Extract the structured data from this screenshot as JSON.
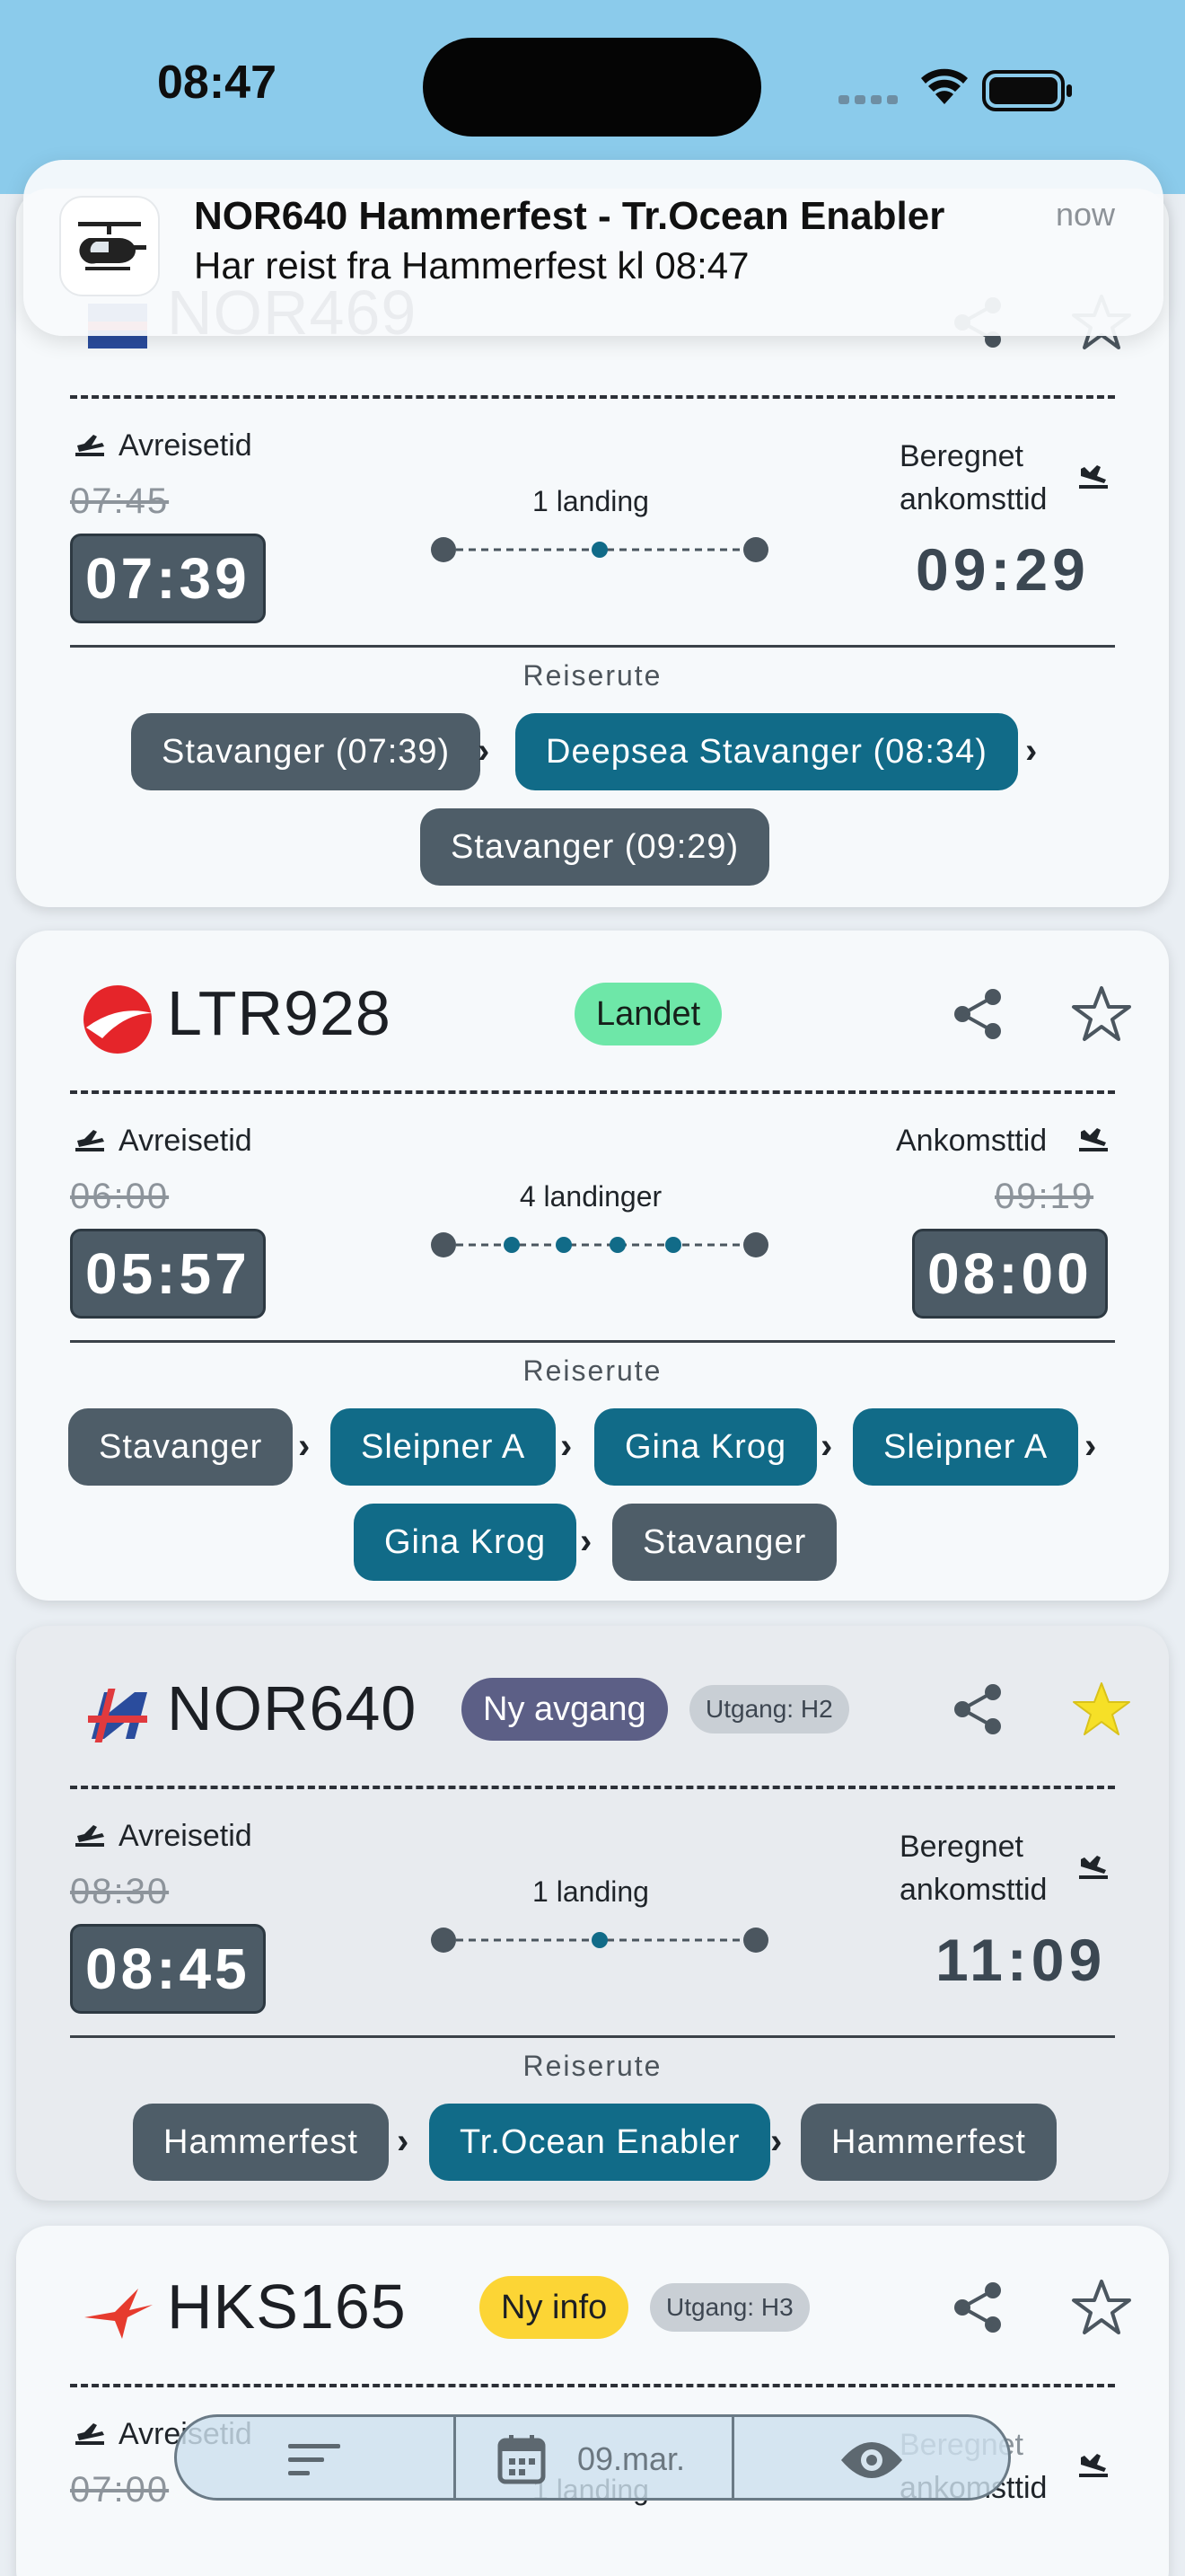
{
  "status_bar": {
    "time": "08:47"
  },
  "notification": {
    "app_icon": "helicopter-icon",
    "title": "NOR640 Hammerfest - Tr.Ocean Enabler",
    "body": "Har reist fra Hammerfest kl 08:47",
    "time": "now"
  },
  "cards": [
    {
      "flight": "NOR469",
      "departure_label": "Avreisetid",
      "departure_scheduled": "07:45",
      "departure_actual": "07:39",
      "landings": "1 landing",
      "arrival_label_line1": "Beregnet",
      "arrival_label_line2": "ankomsttid",
      "arrival_estimated": "09:29",
      "route_title": "Reiserute",
      "route": [
        "Stavanger (07:39)",
        "Deepsea Stavanger (08:34)",
        "Stavanger (09:29)"
      ]
    },
    {
      "flight": "LTR928",
      "status": "Landet",
      "departure_label": "Avreisetid",
      "departure_scheduled": "06:00",
      "departure_actual": "05:57",
      "landings": "4 landinger",
      "arrival_label": "Ankomsttid",
      "arrival_scheduled": "09:19",
      "arrival_actual": "08:00",
      "route_title": "Reiserute",
      "route": [
        "Stavanger",
        "Sleipner A",
        "Gina Krog",
        "Sleipner A",
        "Gina Krog",
        "Stavanger"
      ]
    },
    {
      "flight": "NOR640",
      "status": "Ny avgang",
      "gate": "Utgang: H2",
      "favorite": true,
      "departure_label": "Avreisetid",
      "departure_scheduled": "08:30",
      "departure_actual": "08:45",
      "landings": "1 landing",
      "arrival_label_line1": "Beregnet",
      "arrival_label_line2": "ankomsttid",
      "arrival_estimated": "11:09",
      "route_title": "Reiserute",
      "route": [
        "Hammerfest",
        "Tr.Ocean Enabler",
        "Hammerfest"
      ]
    },
    {
      "flight": "HKS165",
      "status": "Ny info",
      "gate": "Utgang: H3",
      "departure_label": "Avreisetid",
      "departure_scheduled": "07:00",
      "landings": "1 landing",
      "arrival_label_line1": "Beregnet",
      "arrival_label_line2": "ankomsttid"
    }
  ],
  "bottom_bar": {
    "filter_icon": "sort-lines-icon",
    "date_icon": "calendar-icon",
    "date": "09.mar.",
    "view_icon": "eye-icon"
  },
  "colors": {
    "status_bar_bg": "#8bcbeb",
    "chip_grey": "#4e5d68",
    "chip_teal": "#116b88",
    "badge_landet": "#6ee7a8",
    "badge_ny_avgang": "#5c5f86",
    "badge_ny_info": "#fcd535",
    "favorite_star": "#f6e027"
  }
}
